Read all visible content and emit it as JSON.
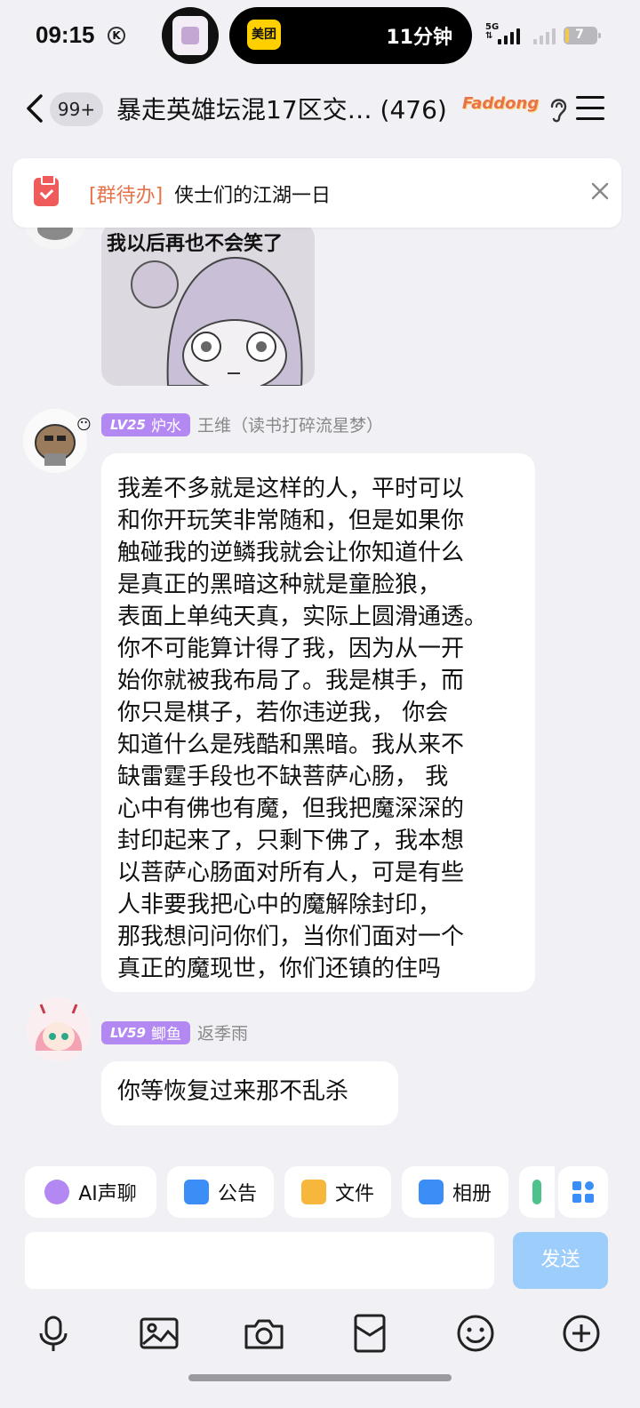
{
  "status_bar": {
    "time": "09:15",
    "k_badge": "K",
    "island_app": "美团",
    "island_text": "11分钟",
    "network": "5G",
    "battery": "7",
    "battery_level": 0.07
  },
  "header": {
    "unread_count": "99+",
    "title": "暴走英雄坛混17区交… (476)",
    "logo_text": "Faddong"
  },
  "pinned_todo": {
    "tag": "[群待办]",
    "text": "侠士们的江湖一日"
  },
  "messages": [
    {
      "type": "sticker",
      "caption": "我以后再也不会笑了"
    },
    {
      "level": "LV25",
      "title": "炉水",
      "nickname": "王维（读书打碎流星梦）",
      "lines": [
        "我差不多就是这样的人，平时可以",
        "和你开玩笑非常随和，但是如果你",
        "触碰我的逆鳞我就会让你知道什么",
        "是真正的黑暗这种就是童脸狼，",
        "表面上单纯天真，实际上圆滑通透。",
        "你不可能算计得了我，因为从一开",
        "始你就被我布局了。我是棋手，而",
        "你只是棋子，若你违逆我， 你会",
        "知道什么是残酷和黑暗。我从来不",
        "缺雷霆手段也不缺菩萨心肠， 我",
        "心中有佛也有魔，但我把魔深深的",
        "封印起来了，只剩下佛了，我本想",
        "以菩萨心肠面对所有人，可是有些",
        "人非要我把心中的魔解除封印，",
        "那我想问问你们，当你们面对一个",
        "真正的魔现世，你们还镇的住吗"
      ]
    },
    {
      "level": "LV59",
      "title": "鲫鱼",
      "nickname": "返季雨",
      "text": "你等恢复过来那不乱杀"
    }
  ],
  "quick_actions": [
    "AI声聊",
    "公告",
    "文件",
    "相册"
  ],
  "input": {
    "placeholder": "",
    "send_label": "发送"
  },
  "colors": {
    "accent": "#9ccdfb",
    "level_badge": "#b388f2",
    "todo_tag": "#e8734a",
    "background": "#f0f0f5"
  },
  "icons": [
    "back-chevron-icon",
    "ear-icon",
    "menu-icon",
    "todo-clipboard-icon",
    "close-icon",
    "mic-icon",
    "image-icon",
    "camera-icon",
    "red-packet-icon",
    "emoji-icon",
    "plus-icon",
    "apps-icon"
  ]
}
